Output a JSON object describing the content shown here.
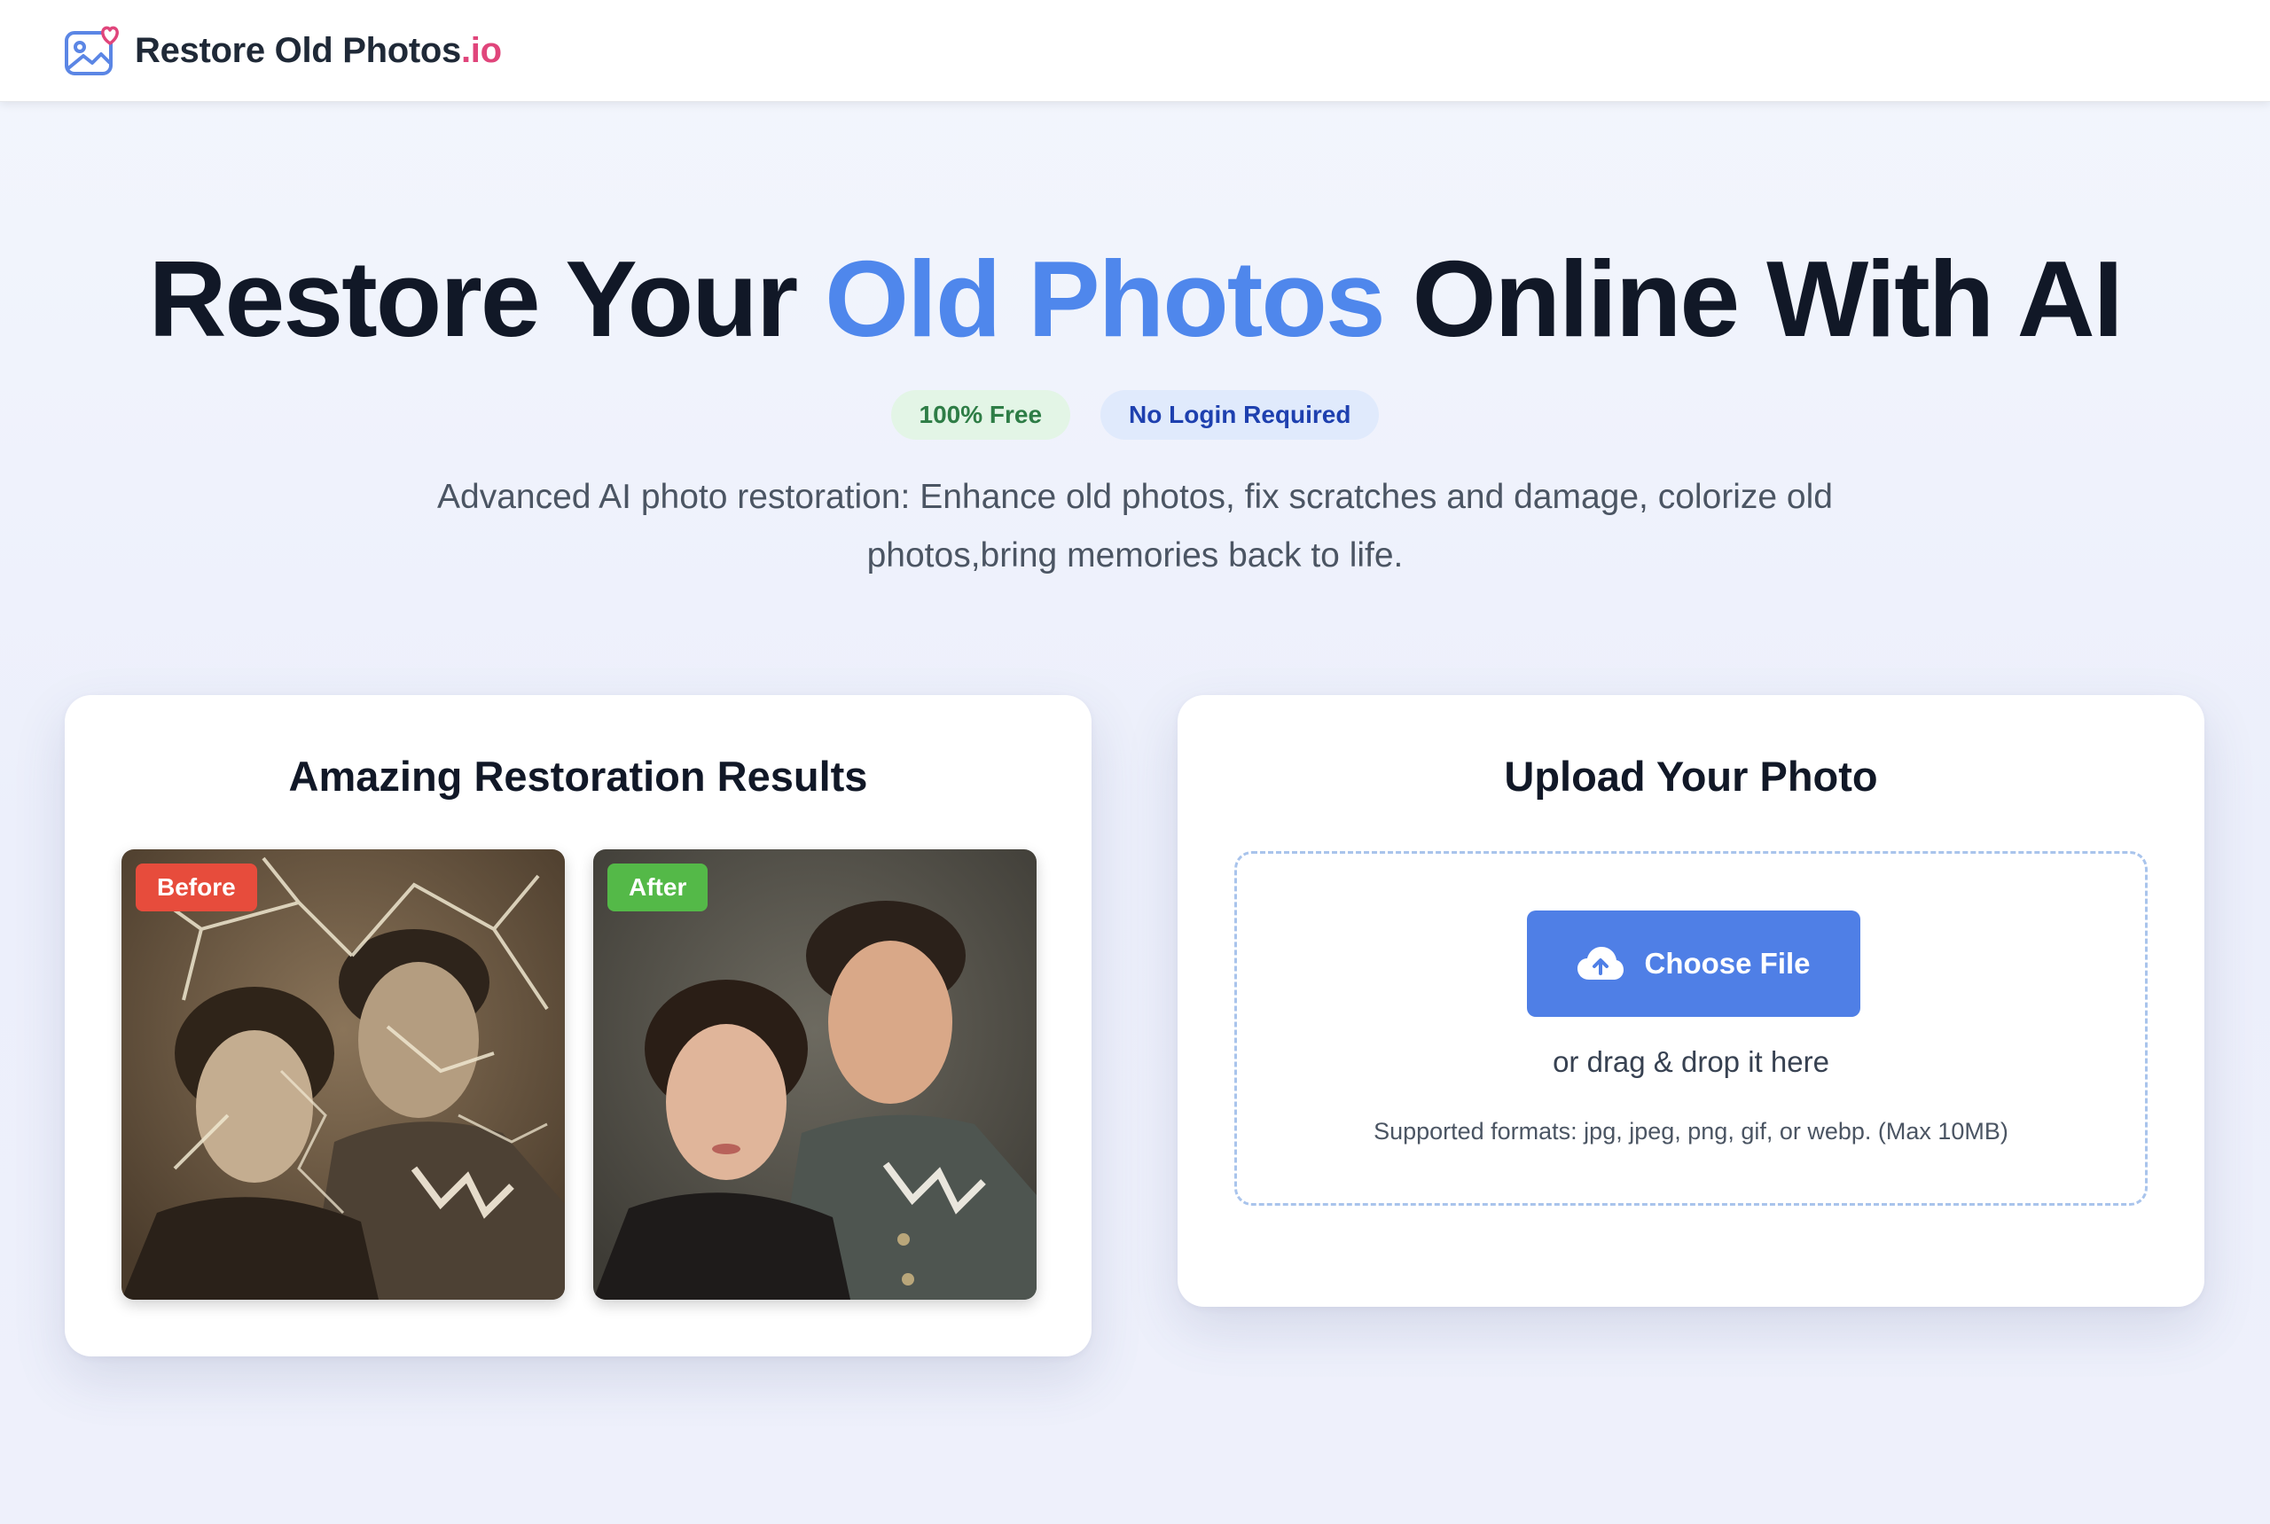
{
  "header": {
    "brand_name": "Restore Old Photos",
    "brand_suffix": ".io",
    "logo_icon": "photo-heart-icon"
  },
  "hero": {
    "title_part1": "Restore Your ",
    "title_highlight": "Old Photos",
    "title_part2": " Online With AI",
    "badge_free": "100% Free",
    "badge_login": "No Login Required",
    "subtitle": "Advanced AI photo restoration: Enhance old photos, fix scratches and damage, colorize old photos,bring memories back to life."
  },
  "results": {
    "title": "Amazing Restoration Results",
    "before_label": "Before",
    "after_label": "After"
  },
  "upload": {
    "title": "Upload Your Photo",
    "button_label": "Choose File",
    "button_icon": "cloud-upload-icon",
    "drag_text": "or drag & drop it here",
    "formats_text": "Supported formats: jpg, jpeg, png, gif, or webp. (Max 10MB)"
  },
  "colors": {
    "accent_blue": "#4f87ec",
    "button_blue": "#4f7fe6",
    "brand_pink": "#e0457b",
    "before_red": "#e74c3c",
    "after_green": "#54b948"
  }
}
